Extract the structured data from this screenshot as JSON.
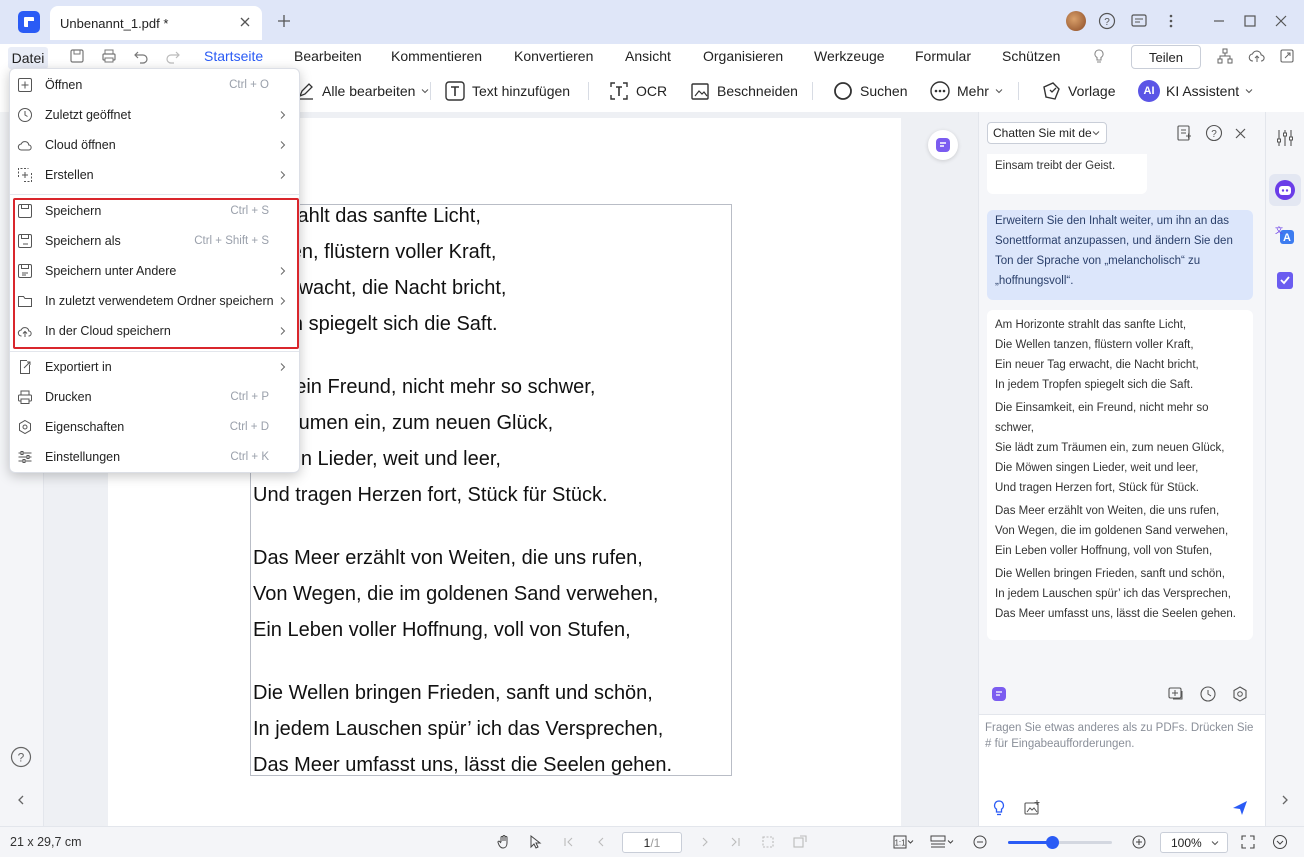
{
  "titlebar": {
    "tab_title": "Unbenannt_1.pdf *"
  },
  "menubar": {
    "file": "Datei",
    "tabs": [
      "Startseite",
      "Bearbeiten",
      "Kommentieren",
      "Konvertieren",
      "Ansicht",
      "Organisieren",
      "Werkzeuge",
      "Formular",
      "Schützen"
    ],
    "share": "Teilen"
  },
  "toolbar": {
    "edit_all": "Alle bearbeiten",
    "add_text": "Text hinzufügen",
    "ocr": "OCR",
    "crop": "Beschneiden",
    "search": "Suchen",
    "more": "Mehr",
    "template": "Vorlage",
    "ai_badge": "AI",
    "ai_assistant": "KI Assistent"
  },
  "file_menu": {
    "items": [
      {
        "label": "Öffnen",
        "shortcut": "Ctrl + O",
        "icon": "open-icon"
      },
      {
        "label": "Zuletzt geöffnet",
        "shortcut": "",
        "icon": "clock-icon",
        "submenu": true
      },
      {
        "label": "Cloud öffnen",
        "shortcut": "",
        "icon": "cloud-icon",
        "submenu": true
      },
      {
        "label": "Erstellen",
        "shortcut": "",
        "icon": "create-icon",
        "submenu": true
      },
      {
        "label": "Speichern",
        "shortcut": "Ctrl + S",
        "icon": "save-icon"
      },
      {
        "label": "Speichern als",
        "shortcut": "Ctrl + Shift + S",
        "icon": "save-as-icon"
      },
      {
        "label": "Speichern unter Andere",
        "shortcut": "",
        "icon": "save-other-icon",
        "submenu": true
      },
      {
        "label": "In zuletzt verwendetem Ordner speichern",
        "shortcut": "",
        "icon": "folder-icon",
        "submenu": true
      },
      {
        "label": "In der Cloud speichern",
        "shortcut": "",
        "icon": "cloud-upload-icon",
        "submenu": true
      },
      {
        "label": "Exportiert in",
        "shortcut": "",
        "icon": "export-icon",
        "submenu": true
      },
      {
        "label": "Drucken",
        "shortcut": "Ctrl + P",
        "icon": "print-icon"
      },
      {
        "label": "Eigenschaften",
        "shortcut": "Ctrl + D",
        "icon": "properties-icon"
      },
      {
        "label": "Einstellungen",
        "shortcut": "Ctrl + K",
        "icon": "settings-icon"
      }
    ]
  },
  "document": {
    "lines": [
      "te strahlt das sanfte Licht,",
      "tanzen, flüstern voller Kraft,",
      "ag erwacht, die Nacht bricht,",
      "opfen spiegelt sich die Saft.",
      "keit, ein Freund, nicht mehr so schwer,",
      "n Träumen ein, zum neuen Glück,",
      "singen Lieder, weit und leer,",
      "Und tragen Herzen fort, Stück für Stück.",
      "Das Meer erzählt von Weiten, die uns rufen,",
      "Von Wegen, die im goldenen Sand verwehen,",
      "Ein Leben voller Hoffnung, voll von Stufen,",
      "Die Wellen bringen Frieden, sanft und schön,",
      "In jedem Lauschen spür’ ich das Versprechen,",
      "Das Meer umfasst uns, lässt die Seelen gehen."
    ]
  },
  "chat": {
    "select": "Chatten Sie mit de",
    "prev_response_tail": "Einsam treibt der Geist.",
    "user_prompt": "Erweitern Sie den Inhalt weiter, um ihn an das Sonettformat anzupassen, und ändern Sie den Ton der Sprache von „melancholisch“ zu „hoffnungsvoll“.",
    "response_lines": [
      "Am Horizonte strahlt das sanfte Licht,",
      "Die Wellen tanzen, flüstern voller Kraft,",
      "Ein neuer Tag erwacht, die Nacht bricht,",
      "In jedem Tropfen spiegelt sich die Saft.",
      "Die Einsamkeit, ein Freund, nicht mehr so schwer,",
      "Sie lädt zum Träumen ein, zum neuen Glück,",
      "Die Möwen singen Lieder, weit und leer,",
      "Und tragen Herzen fort, Stück für Stück.",
      "Das Meer erzählt von Weiten, die uns rufen,",
      "Von Wegen, die im goldenen Sand verwehen,",
      "Ein Leben voller Hoffnung, voll von Stufen,",
      "Die Wellen bringen Frieden, sanft und schön,",
      "In jedem Lauschen spür’ ich das Versprechen,",
      "Das Meer umfasst uns, lässt die Seelen gehen."
    ],
    "input_placeholder": "Fragen Sie etwas anderes als zu PDFs. Drücken Sie # für Eingabeaufforderungen."
  },
  "status": {
    "page_size": "21 x 29,7 cm",
    "page_current": "1",
    "page_total": "/1",
    "zoom": "100%",
    "zoom_level": 0.42
  },
  "colors": {
    "accent": "#2a5bf5",
    "highlight_border": "#d9262c"
  }
}
